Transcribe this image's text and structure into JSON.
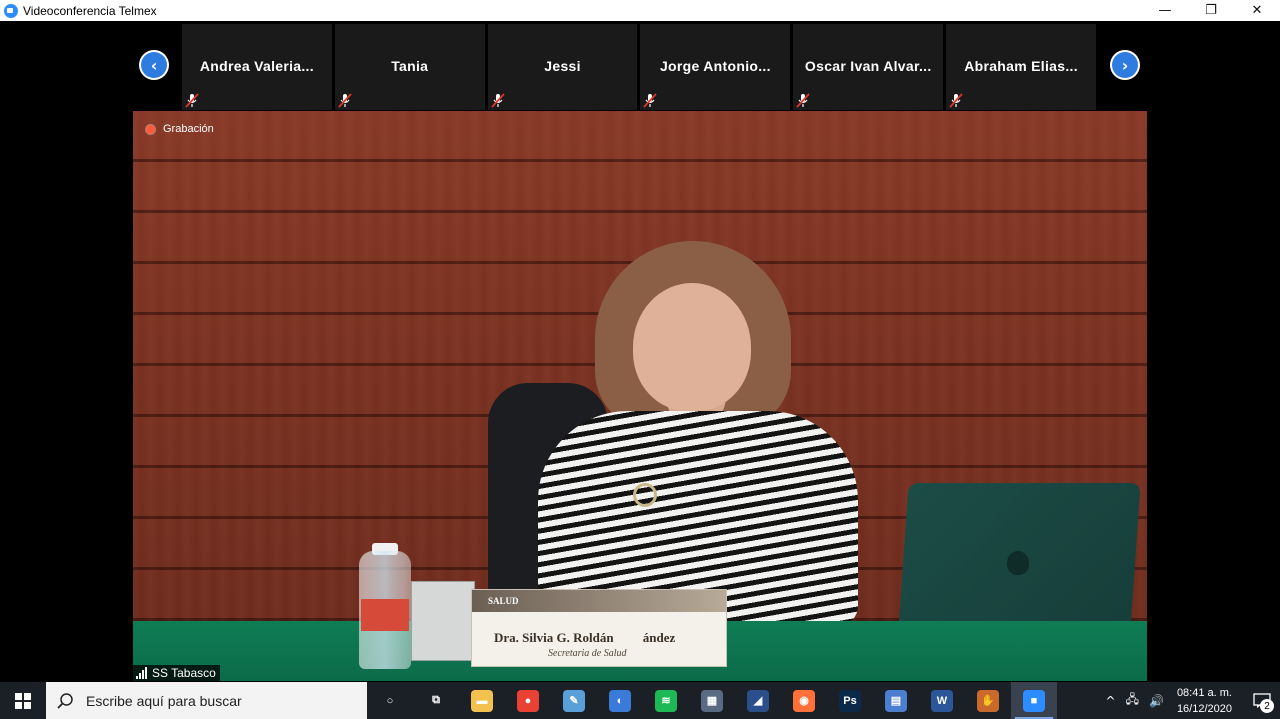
{
  "window": {
    "title": "Videoconferencia Telmex",
    "minimize": "—",
    "restore": "❐",
    "close": "✕"
  },
  "participants": {
    "prev_label": "‹",
    "next_label": "›",
    "items": [
      {
        "name": "Andrea  Valeria..."
      },
      {
        "name": "Tania"
      },
      {
        "name": "Jessi"
      },
      {
        "name": "Jorge  Antonio..."
      },
      {
        "name": "Oscar  Ivan  Alvar..."
      },
      {
        "name": "Abraham  Elias..."
      }
    ]
  },
  "video": {
    "recording_label": "Grabación",
    "speaker_label": "SS Tabasco",
    "nameplate": {
      "header": "SALUD",
      "name": "Dra. Silvia G. Roldán",
      "name_suffix": "ández",
      "role": "Secretaria de Salud"
    },
    "accent_color": "#2d8cff",
    "recording_color": "#ff5a3c"
  },
  "taskbar": {
    "search_placeholder": "Escribe aquí para buscar",
    "apps": [
      {
        "icon": "cortana-icon",
        "glyph": "○",
        "color": "transparent"
      },
      {
        "icon": "task-view-icon",
        "glyph": "⧉",
        "color": "transparent"
      },
      {
        "icon": "file-explorer-icon",
        "glyph": "▬",
        "color": "#f2c14e"
      },
      {
        "icon": "chrome-icon",
        "glyph": "●",
        "color": "#e94235"
      },
      {
        "icon": "paint-icon",
        "glyph": "✎",
        "color": "#5aa0d8"
      },
      {
        "icon": "browser-icon",
        "glyph": "◐",
        "color": "#3a7ad9"
      },
      {
        "icon": "spotify-icon",
        "glyph": "≋",
        "color": "#1db954"
      },
      {
        "icon": "calculator-icon",
        "glyph": "▦",
        "color": "#596b82"
      },
      {
        "icon": "media-app-icon",
        "glyph": "◢",
        "color": "#2b4f8c"
      },
      {
        "icon": "firefox-icon",
        "glyph": "◉",
        "color": "#ff7139"
      },
      {
        "icon": "photoshop-icon",
        "glyph": "Ps",
        "color": "#0b2a4a"
      },
      {
        "icon": "files-app-icon",
        "glyph": "▤",
        "color": "#4b7fd1"
      },
      {
        "icon": "word-icon",
        "glyph": "W",
        "color": "#2b579a"
      },
      {
        "icon": "game-app-icon",
        "glyph": "✋",
        "color": "#c96a2c"
      },
      {
        "icon": "zoom-icon",
        "glyph": "■",
        "color": "#2d8cff"
      }
    ],
    "tray": {
      "chevron": "^",
      "network": "🖧",
      "volume": "🔊",
      "time": "08:41 a. m.",
      "date": "16/12/2020",
      "notifications_count": "2"
    }
  }
}
